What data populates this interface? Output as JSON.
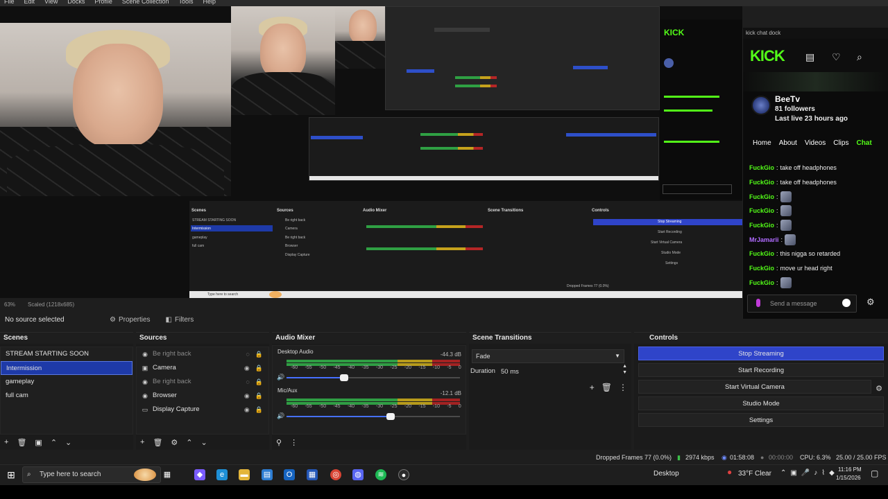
{
  "menu": [
    "File",
    "Edit",
    "View",
    "Docks",
    "Profile",
    "Scene Collection",
    "Tools",
    "Help"
  ],
  "preview": {
    "zoom": "63%",
    "scaled": "Scaled (1218x685)"
  },
  "source_bar": {
    "status": "No source selected",
    "properties": "Properties",
    "filters": "Filters"
  },
  "scenes": {
    "title": "Scenes",
    "items": [
      "STREAM STARTING SOON",
      "Intermission",
      "gameplay",
      "full cam"
    ],
    "selected_index": 1
  },
  "sources": {
    "title": "Sources",
    "items": [
      {
        "label": "Be right back",
        "icon": "browser-icon",
        "dim": true
      },
      {
        "label": "Camera",
        "icon": "camera-icon",
        "dim": false
      },
      {
        "label": "Be right back",
        "icon": "browser-icon",
        "dim": true
      },
      {
        "label": "Browser",
        "icon": "browser-icon",
        "dim": false
      },
      {
        "label": "Display Capture",
        "icon": "display-icon",
        "dim": false
      }
    ]
  },
  "audio_mixer": {
    "title": "Audio Mixer",
    "channels": [
      {
        "name": "Desktop Audio",
        "db": "-44.3 dB",
        "fader_level": 0.33
      },
      {
        "name": "Mic/Aux",
        "db": "-12.1 dB",
        "fader_level": 0.6
      }
    ],
    "scale": [
      "-60",
      "-55",
      "-50",
      "-45",
      "-40",
      "-35",
      "-30",
      "-25",
      "-20",
      "-15",
      "-10",
      "-5",
      "0"
    ]
  },
  "scene_transitions": {
    "title": "Scene Transitions",
    "transition": "Fade",
    "duration_label": "Duration",
    "duration_value": "50 ms"
  },
  "controls": {
    "title": "Controls",
    "buttons": [
      "Stop Streaming",
      "Start Recording",
      "Start Virtual Camera",
      "Studio Mode",
      "Settings"
    ]
  },
  "status": {
    "dropped": "Dropped Frames 77 (0.0%)",
    "bitrate": "2974 kbps",
    "stream_time": "01:58:08",
    "rec_time": "00:00:00",
    "cpu": "CPU: 6.3%",
    "fps": "25.00 / 25.00 FPS"
  },
  "taskbar": {
    "search_placeholder": "Type here to search",
    "desktop": "Desktop",
    "weather": "33°F  Clear",
    "time": "11:16 PM",
    "date": "1/15/2026"
  },
  "kick": {
    "dock_title": "kick chat dock",
    "logo": "KICK",
    "channel": "BeeTv",
    "followers": "81 followers",
    "last_live": "Last live 23 hours ago",
    "nav": [
      "Home",
      "About",
      "Videos",
      "Clips",
      "Chat"
    ],
    "active_nav": "Chat",
    "messages": [
      {
        "user": "FuckGio",
        "text": "take off headphones",
        "emote": false
      },
      {
        "user": "FuckGio",
        "text": "take off headphones",
        "emote": false
      },
      {
        "user": "FuckGio",
        "text": "",
        "emote": true
      },
      {
        "user": "FuckGio",
        "text": "",
        "emote": true
      },
      {
        "user": "FuckGio",
        "text": "",
        "emote": true
      },
      {
        "user": "MrJamarii",
        "text": "",
        "emote": true
      },
      {
        "user": "FuckGio",
        "text": "this nigga so retarded",
        "emote": false
      },
      {
        "user": "FuckGio",
        "text": "move ur head right",
        "emote": false
      },
      {
        "user": "FuckGio",
        "text": "",
        "emote": true
      }
    ],
    "input_placeholder": "Send a message"
  },
  "colors": {
    "accent": "#2f44c9",
    "kick_green": "#53fc18",
    "selected_scene": "#1e3aa8"
  }
}
